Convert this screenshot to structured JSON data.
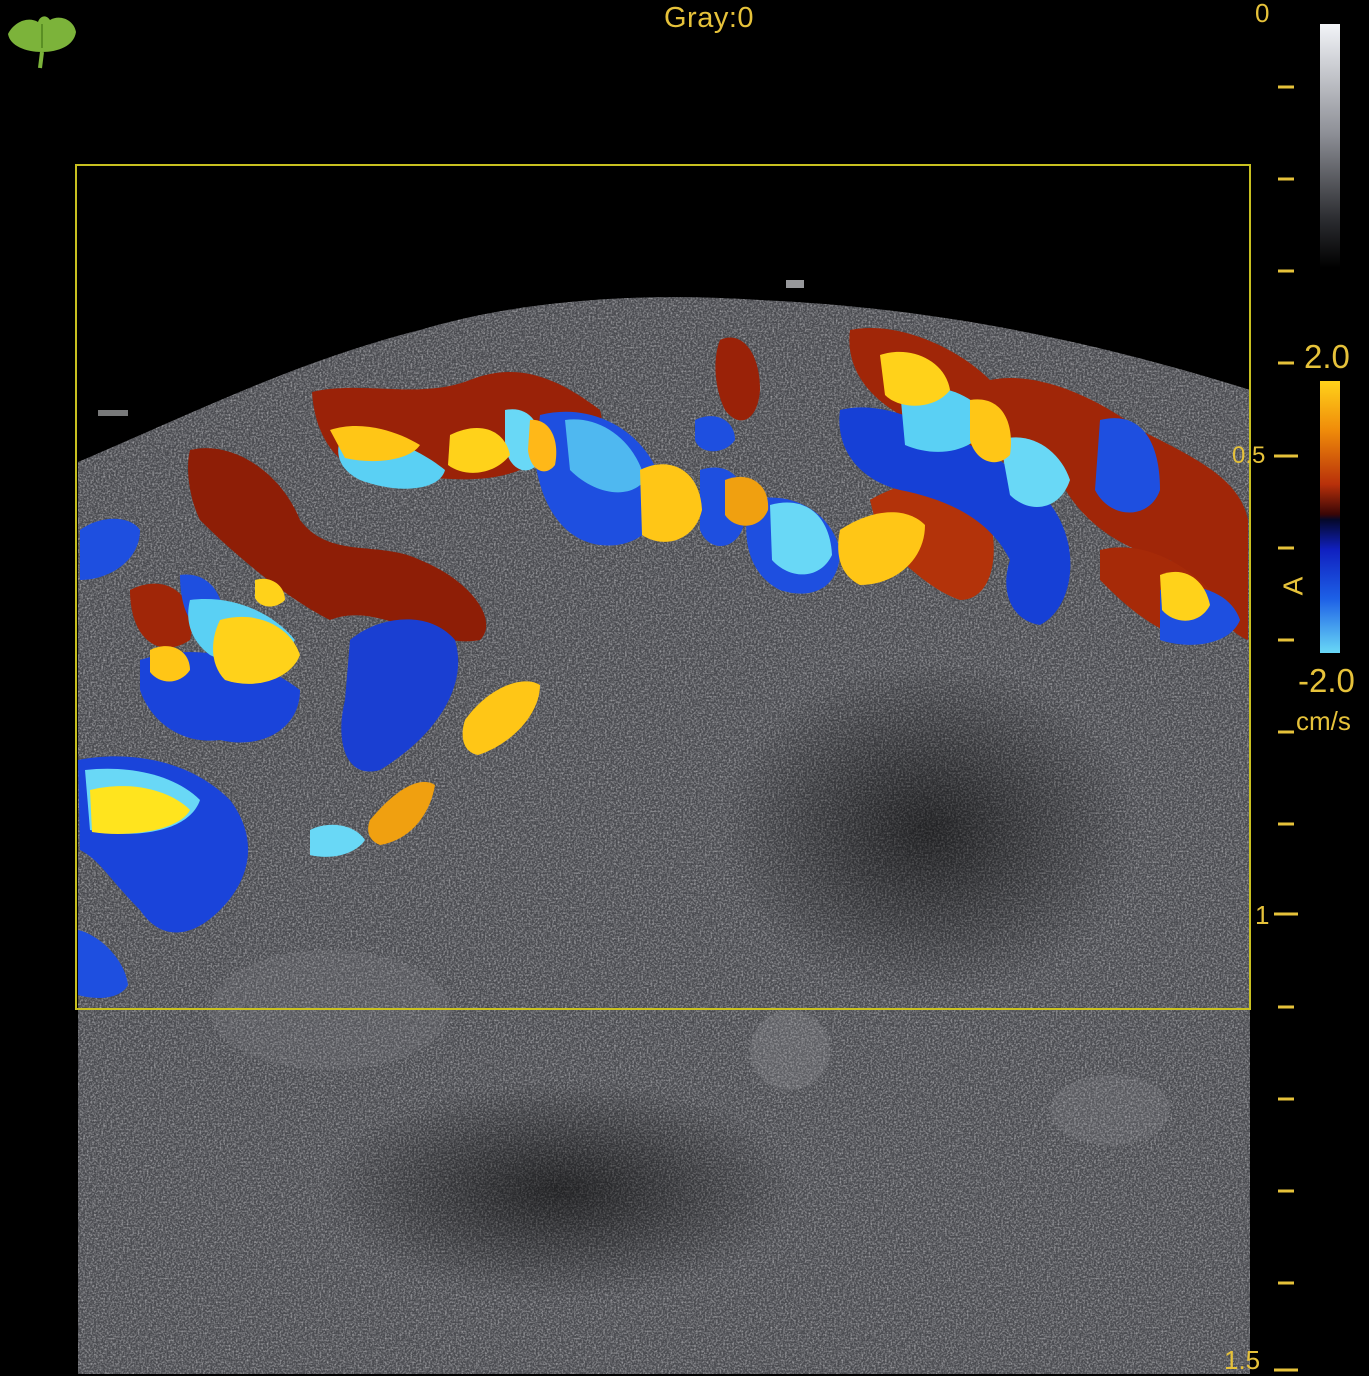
{
  "header": {
    "gray_label": "Gray:0"
  },
  "depth_scale": {
    "labels": [
      "0",
      "0.5",
      "1",
      "1.5"
    ]
  },
  "gray_map": {
    "name": "grayscale-map"
  },
  "velocity_scale": {
    "max": "2.0",
    "min": "-2.0",
    "unit": "cm/s",
    "direction_symbol": "A"
  },
  "colors": {
    "overlay_text": "#e6c23a",
    "roi_border": "#c8c020",
    "flow_toward": "#f0a010",
    "flow_away": "#1e4fe0"
  },
  "icons": {
    "logo": "ginkgo-leaf-icon"
  }
}
